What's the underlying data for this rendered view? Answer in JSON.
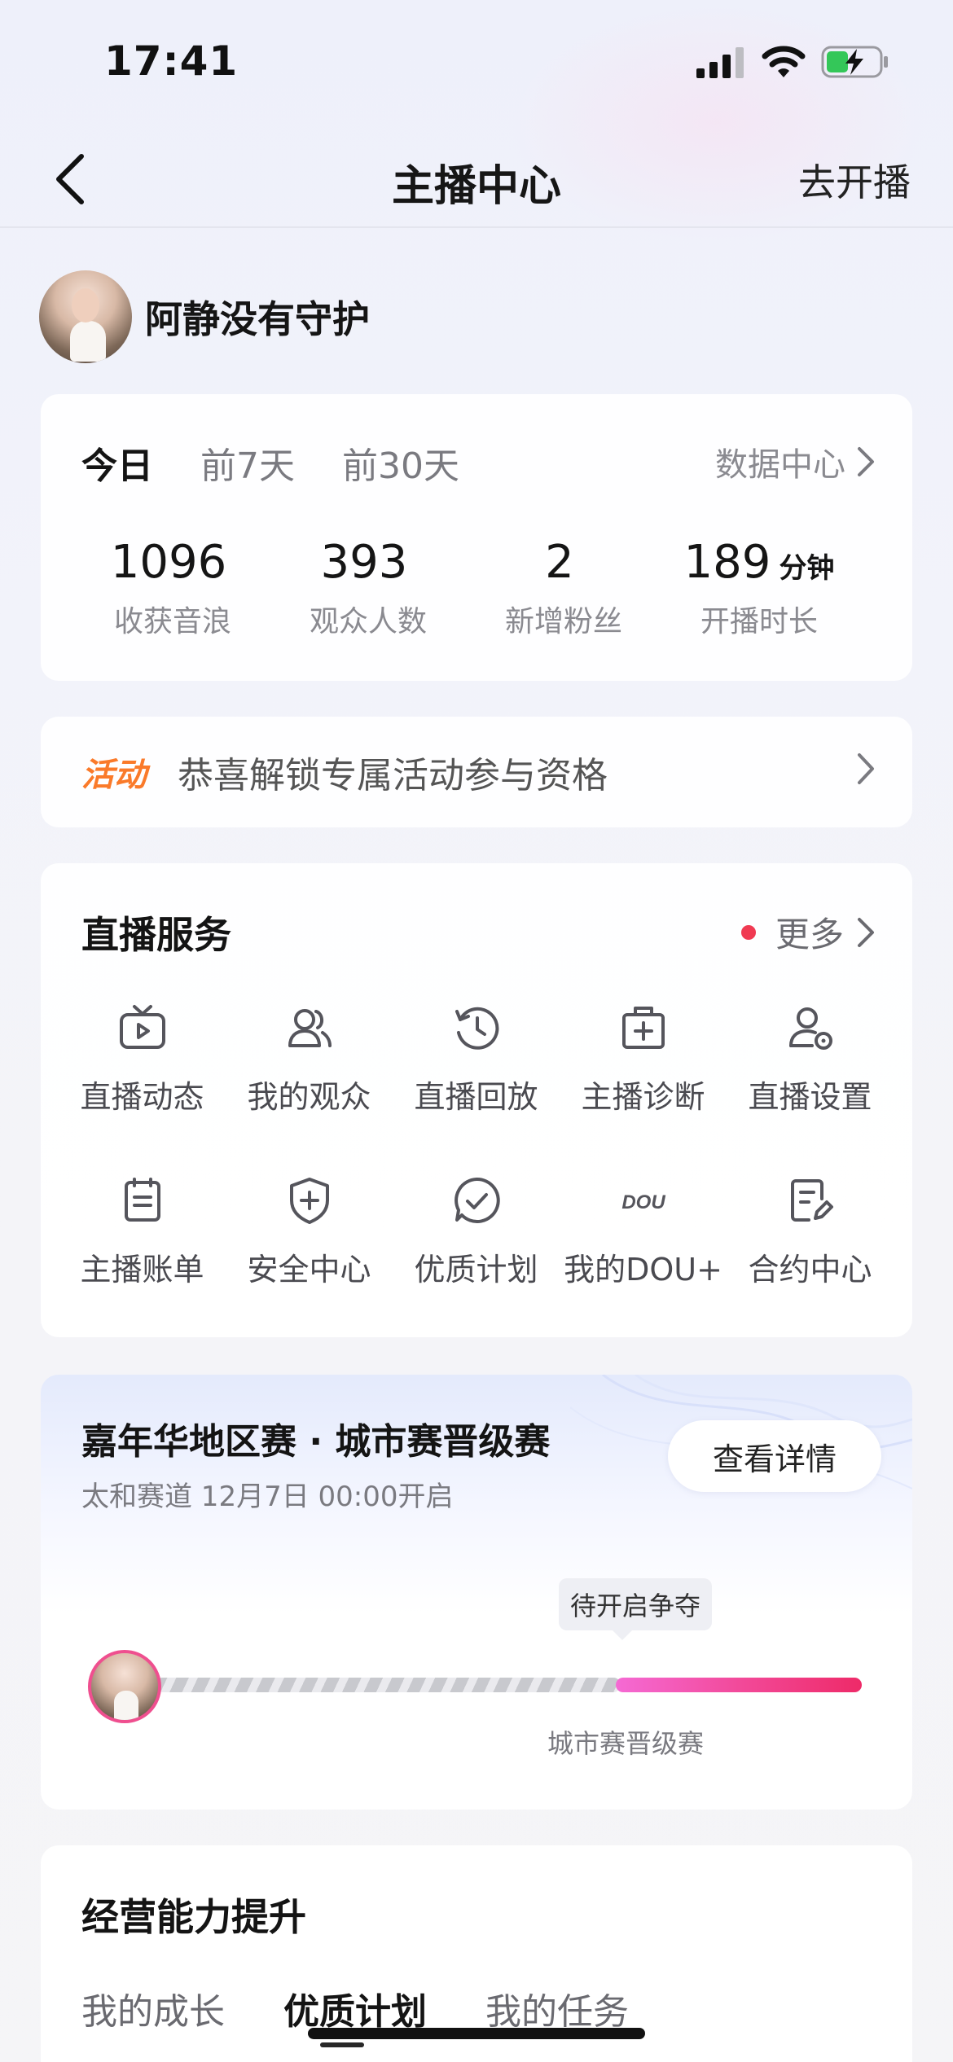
{
  "status_bar": {
    "time": "17:41"
  },
  "nav": {
    "title": "主播中心",
    "action_label": "去开播"
  },
  "profile": {
    "name": "阿静没有守护"
  },
  "stats": {
    "tabs": [
      "今日",
      "前7天",
      "前30天"
    ],
    "active_tab": "今日",
    "data_center_label": "数据中心",
    "items": [
      {
        "value": "1096",
        "unit": "",
        "label": "收获音浪"
      },
      {
        "value": "393",
        "unit": "",
        "label": "观众人数"
      },
      {
        "value": "2",
        "unit": "",
        "label": "新增粉丝"
      },
      {
        "value": "189",
        "unit": "分钟",
        "label": "开播时长"
      }
    ]
  },
  "activity": {
    "tag": "活动",
    "text": "恭喜解锁专属活动参与资格"
  },
  "services": {
    "title": "直播服务",
    "more_label": "更多",
    "items": [
      {
        "label": "直播动态",
        "icon": "tv-play-icon"
      },
      {
        "label": "我的观众",
        "icon": "users-icon"
      },
      {
        "label": "直播回放",
        "icon": "history-clock-icon"
      },
      {
        "label": "主播诊断",
        "icon": "medical-kit-icon"
      },
      {
        "label": "直播设置",
        "icon": "user-settings-icon"
      },
      {
        "label": "主播账单",
        "icon": "bill-icon"
      },
      {
        "label": "安全中心",
        "icon": "shield-plus-icon"
      },
      {
        "label": "优质计划",
        "icon": "check-bubble-icon"
      },
      {
        "label": "我的DOU+",
        "icon": "dou-plus-icon",
        "icon_text": "DOU"
      },
      {
        "label": "合约中心",
        "icon": "contract-edit-icon"
      }
    ]
  },
  "carnival": {
    "title": "嘉年华地区赛 · 城市赛晋级赛",
    "subtitle": "太和赛道 12月7日 00:00开启",
    "detail_button": "查看详情",
    "tooltip": "待开启争夺",
    "stage_label": "城市赛晋级赛",
    "progress_fraction": 0.58,
    "accent_color": "#ee2a68"
  },
  "growth": {
    "title": "经营能力提升",
    "tabs": [
      "我的成长",
      "优质计划",
      "我的任务"
    ],
    "active_tab": "优质计划"
  },
  "colors": {
    "activity_orange": "#fa7a2a",
    "dot_red": "#f03a52",
    "progress_pink": "#f24a9a"
  }
}
